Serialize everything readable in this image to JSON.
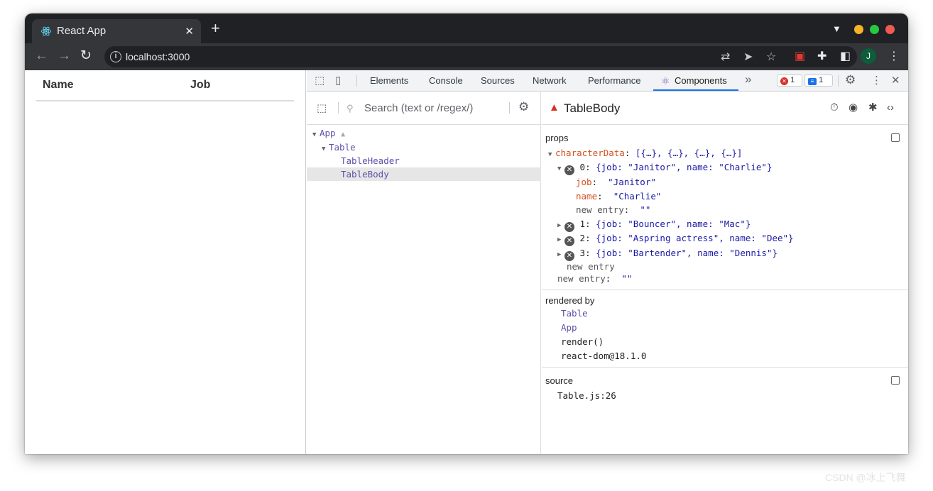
{
  "browser": {
    "tab_title": "React App",
    "tab_close": "✕",
    "new_tab": "+",
    "url": "localhost:3000",
    "avatar_initial": "J",
    "window_colors": {
      "minimize": "#f5b427",
      "maximize": "#28c840",
      "close": "#ee5b52"
    }
  },
  "page": {
    "headers": [
      "Name",
      "Job"
    ]
  },
  "devtools": {
    "tabs": [
      "Elements",
      "Console",
      "Sources",
      "Network",
      "Performance",
      "Components"
    ],
    "active_tab": "Components",
    "more_tabs": "»",
    "errors": "1",
    "messages": "1",
    "search_placeholder": "Search (text or /regex/)",
    "tree": [
      {
        "label": "App",
        "depth": 0,
        "expanded": true,
        "warning": true
      },
      {
        "label": "Table",
        "depth": 1,
        "expanded": true
      },
      {
        "label": "TableHeader",
        "depth": 2
      },
      {
        "label": "TableBody",
        "depth": 2,
        "selected": true
      }
    ],
    "selected_component": "TableBody",
    "props_label": "props",
    "props": {
      "characterData_key": "characterData",
      "characterData_summary": "[{…}, {…}, {…}, {…}]",
      "items": [
        {
          "index": "0",
          "summary": "{job: \"Janitor\", name: \"Charlie\"}",
          "expanded": true,
          "fields": [
            {
              "key": "job",
              "value": "\"Janitor\""
            },
            {
              "key": "name",
              "value": "\"Charlie\""
            }
          ],
          "new_entry": "new entry",
          "new_entry_value": "\"\""
        },
        {
          "index": "1",
          "summary": "{job: \"Bouncer\", name: \"Mac\"}"
        },
        {
          "index": "2",
          "summary": "{job: \"Aspring actress\", name: \"Dee\"}"
        },
        {
          "index": "3",
          "summary": "{job: \"Bartender\", name: \"Dennis\"}"
        }
      ],
      "array_new_entry": "new entry",
      "root_new_entry": "new entry",
      "root_new_entry_value": "\"\""
    },
    "rendered_by_label": "rendered by",
    "rendered_by": [
      "Table",
      "App",
      "render()",
      "react-dom@18.1.0"
    ],
    "source_label": "source",
    "source": "Table.js:26"
  },
  "watermark": "CSDN @冰上飞舞"
}
